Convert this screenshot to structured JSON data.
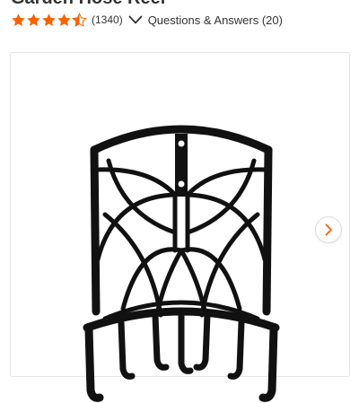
{
  "product": {
    "title": "Garden Hose Reel"
  },
  "rating": {
    "stars": 4.5,
    "max_stars": 5,
    "review_count_text": "(1340)",
    "star_color": "#f96302"
  },
  "qa": {
    "label": "Questions & Answers (20)",
    "icon": "chevron-down-icon"
  },
  "gallery": {
    "image_alt": "black metal wall-mounted garden hose holder",
    "next_icon": "chevron-right-icon",
    "accent_color": "#f96302"
  }
}
